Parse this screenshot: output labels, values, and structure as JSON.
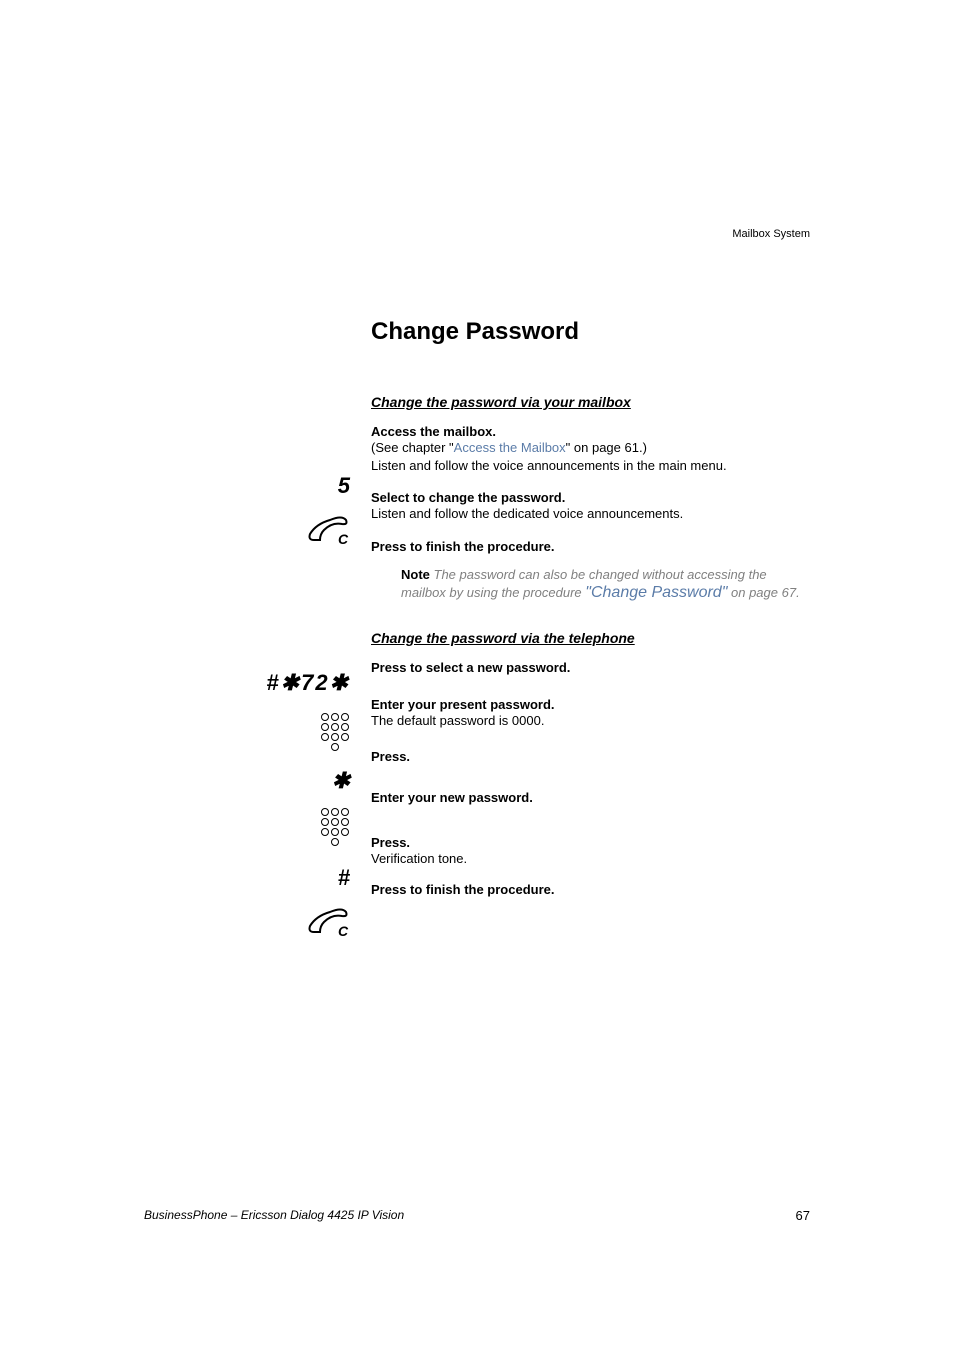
{
  "header": {
    "running": "Mailbox System"
  },
  "title": "Change Password",
  "section1": {
    "heading": "Change the password via your mailbox",
    "step1_bold": "Access the mailbox.",
    "step1_line_a": "(See chapter \"",
    "step1_link": "Access the Mailbox",
    "step1_line_b": "\" on page 61.)",
    "step1_line2": "Listen and follow the voice announcements in the main menu.",
    "step2_glyph": "5",
    "step2_bold": "Select to change the password.",
    "step2_line": "Listen and follow the dedicated voice announcements.",
    "step3_bold": "Press to finish the procedure.",
    "note_label": "Note",
    "note_body_a": " The password can also be changed without accessing the mailbox by using the procedure ",
    "note_link": "\"Change Password\"",
    "note_body_b": " on page 67."
  },
  "section2": {
    "heading": "Change the password via the telephone",
    "code_glyph": "#✱72✱",
    "step1_bold": "Press to select a new password.",
    "step2_bold": "Enter your present password.",
    "step2_line": "The default password is 0000.",
    "star_glyph": "✱",
    "step3_bold": "Press.",
    "step4_bold": "Enter your new password.",
    "hash_glyph": "#",
    "step5_bold": "Press.",
    "step5_line": "Verification tone.",
    "step6_bold": "Press to finish the procedure."
  },
  "footer": {
    "product": "BusinessPhone – Ericsson Dialog 4425 IP Vision",
    "page": "67"
  },
  "glyphs": {
    "handset_c": "C"
  }
}
